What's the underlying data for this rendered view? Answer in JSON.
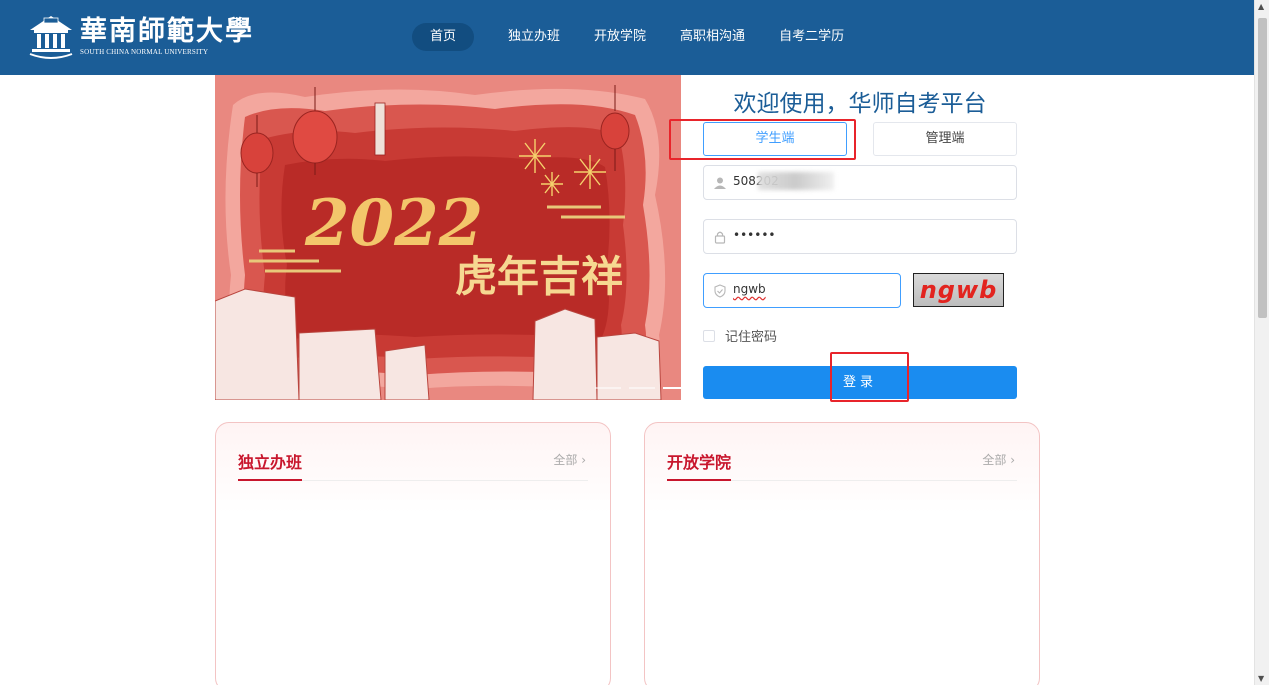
{
  "header": {
    "logo_cn": "華南師範大學",
    "logo_en": "SOUTH CHINA NORMAL UNIVERSITY",
    "nav": [
      "首页",
      "独立办班",
      "开放学院",
      "高职相沟通",
      "自考二学历"
    ],
    "active_nav": "首页",
    "brand_color": "#1b5d97"
  },
  "banner": {
    "year": "2022",
    "blessing": "虎年吉祥"
  },
  "login": {
    "title": "欢迎使用，华师自考平台",
    "tabs": [
      "学生端",
      "管理端"
    ],
    "active_tab": "学生端",
    "username_value": "508202",
    "password_value": "••••••",
    "captcha_value": "ngwb",
    "captcha_image_text": "ngwb",
    "remember_label": "记住密码",
    "remember_checked": false,
    "submit_label": "登录",
    "accent_color": "#1a8cf0"
  },
  "sections": [
    {
      "title": "独立办班",
      "more": "全部 ›"
    },
    {
      "title": "开放学院",
      "more": "全部 ›"
    }
  ],
  "icons": {
    "username": "user-icon",
    "password": "lock-icon",
    "captcha": "shield-check-icon"
  }
}
